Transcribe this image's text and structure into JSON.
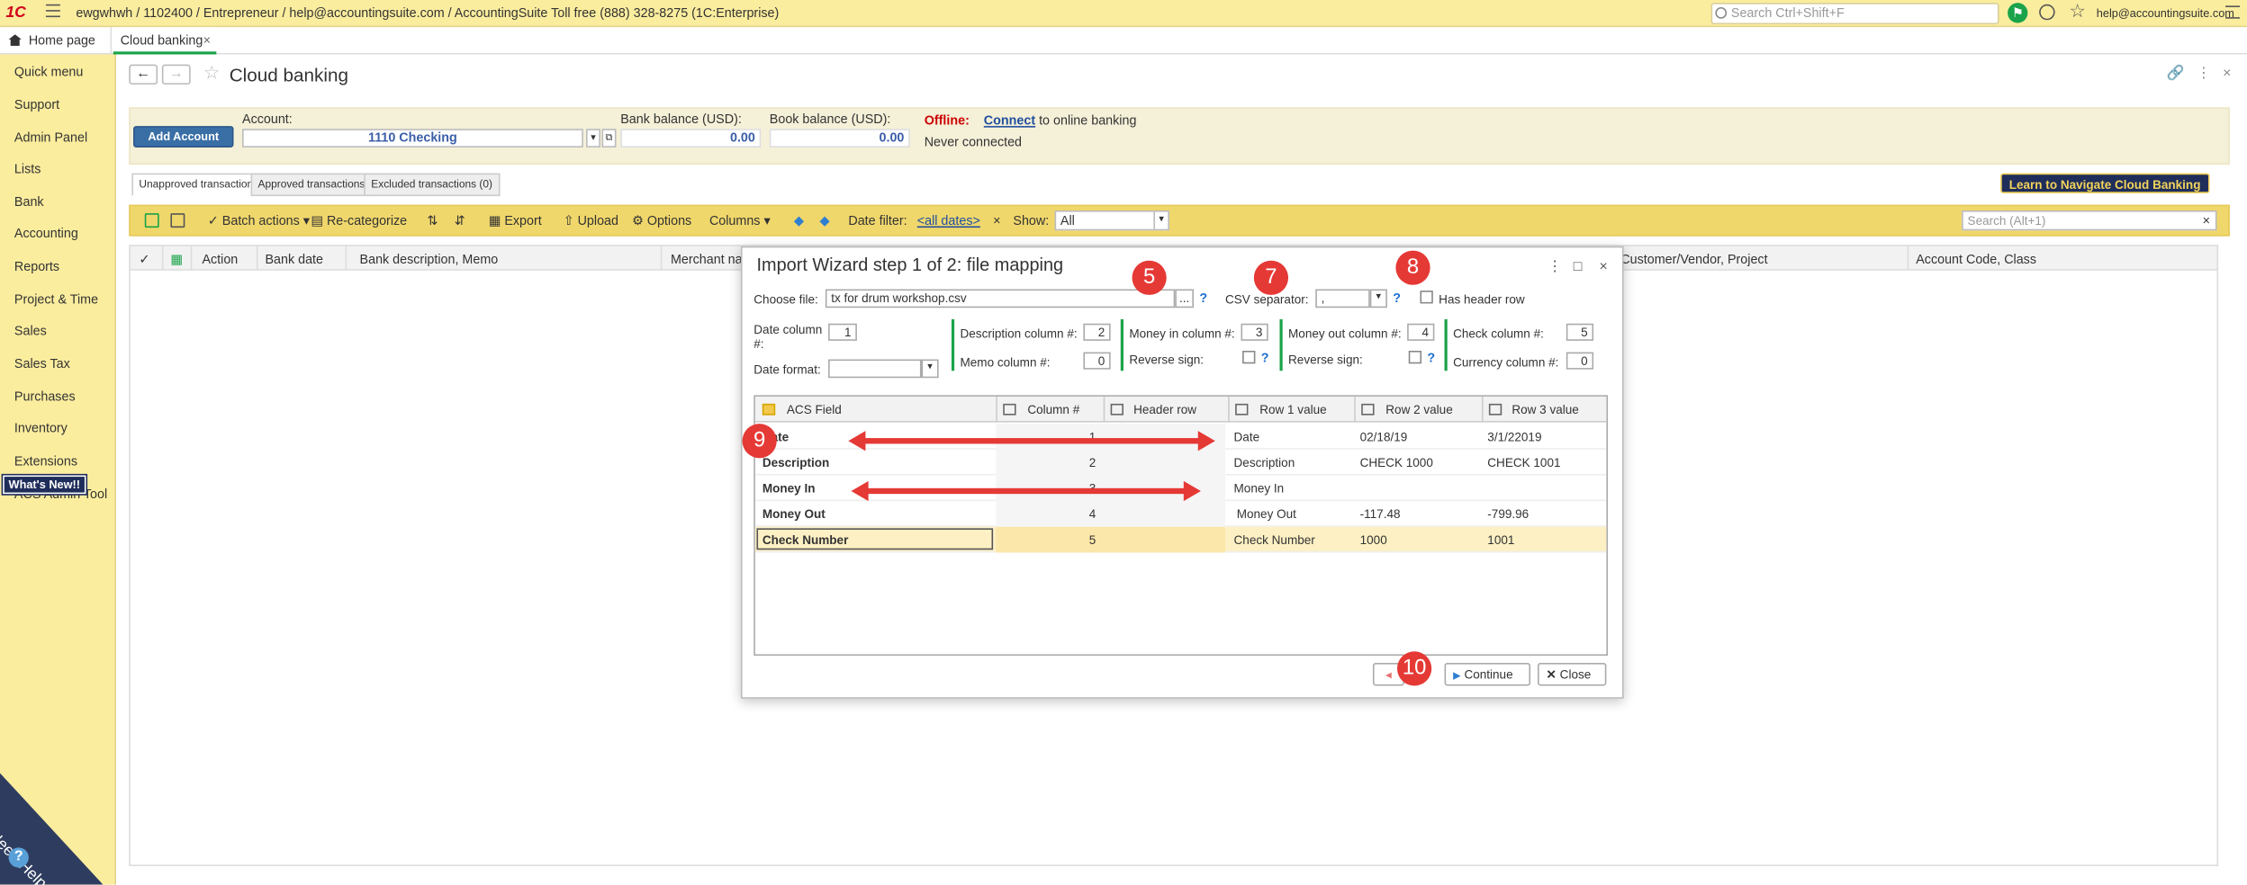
{
  "topbar": {
    "logo": "1C",
    "breadcrumb": "ewgwhwh / 1102400 / Entrepreneur / help@accountingsuite.com / AccountingSuite Toll free (888) 328-8275  (1C:Enterprise)",
    "search_placeholder": "Search Ctrl+Shift+F",
    "user_email": "help@accountingsuite.com"
  },
  "tabs": {
    "home": "Home page",
    "current": "Cloud banking"
  },
  "sidebar": {
    "items": [
      "Quick menu",
      "Support",
      "Admin Panel",
      "Lists",
      "Bank",
      "Accounting",
      "Reports",
      "Project & Time",
      "Sales",
      "Sales Tax",
      "Purchases",
      "Inventory",
      "Extensions"
    ],
    "whats_new": "What's New!!",
    "acs_admin": "ACS Admin Tool",
    "need_help": "Need Help"
  },
  "page": {
    "title": "Cloud banking",
    "add_account": "Add Account",
    "account_label": "Account:",
    "account_value": "1110 Checking",
    "bank_balance_label": "Bank balance (USD):",
    "bank_balance_value": "0.00",
    "book_balance_label": "Book balance (USD):",
    "book_balance_value": "0.00",
    "offline_label": "Offline:",
    "connect_link": "Connect",
    "connect_suffix": " to online banking",
    "never_connected": "Never connected",
    "learn_button": "Learn to Navigate Cloud Banking"
  },
  "trx_tabs": [
    "Unapproved transactions",
    "Approved transactions",
    "Excluded transactions (0)"
  ],
  "toolbar": {
    "batch_actions": "Batch actions",
    "recategorize": "Re-categorize",
    "export": "Export",
    "upload": "Upload",
    "options": "Options",
    "columns": "Columns",
    "date_filter_label": "Date filter:",
    "date_filter_value": "<all dates>",
    "show_label": "Show:",
    "show_value": "All",
    "search_placeholder": "Search (Alt+1)"
  },
  "grid": {
    "columns": [
      "Action",
      "Bank date",
      "Bank description, Memo",
      "Merchant nam",
      "Customer/Vendor, Project",
      "Account Code, Class"
    ]
  },
  "dialog": {
    "title": "Import Wizard step 1 of 2: file mapping",
    "choose_file_label": "Choose file:",
    "choose_file_value": "tx for drum workshop.csv",
    "csv_sep_label": "CSV separator:",
    "csv_sep_value": ",",
    "has_header_label": "Has header row",
    "date_col_label": "Date column #:",
    "date_col_value": "1",
    "date_format_label": "Date format:",
    "desc_col_label": "Description column #:",
    "desc_col_value": "2",
    "memo_col_label": "Memo column #:",
    "memo_col_value": "0",
    "money_in_label": "Money in column #:",
    "money_in_value": "3",
    "rev_sign_label": "Reverse sign:",
    "money_out_label": "Money out column #:",
    "money_out_value": "4",
    "check_col_label": "Check column #:",
    "check_col_value": "5",
    "currency_col_label": "Currency column #:",
    "currency_col_value": "0",
    "table_headers": [
      "ACS Field",
      "Column #",
      "Header row",
      "Row 1 value",
      "Row 2 value",
      "Row 3 value"
    ],
    "rows": [
      {
        "field": "Date",
        "col": "1",
        "header": "",
        "r1": "Date",
        "r2": "02/18/19",
        "r3": "3/1/22019"
      },
      {
        "field": "Description",
        "col": "2",
        "header": "",
        "r1": "Description",
        "r2": "CHECK 1000",
        "r3": "CHECK 1001"
      },
      {
        "field": "Money In",
        "col": "3",
        "header": "",
        "r1": "Money In",
        "r2": "",
        "r3": ""
      },
      {
        "field": "Money Out",
        "col": "4",
        "header": "",
        "r1": "Money Out",
        "r2": "-117.48",
        "r3": "-799.96"
      },
      {
        "field": "Check Number",
        "col": "5",
        "header": "",
        "r1": "Check Number",
        "r2": "1000",
        "r3": "1001"
      }
    ],
    "continue": "Continue",
    "close": "Close"
  },
  "annotations": [
    "5",
    "7",
    "8",
    "9",
    "10"
  ],
  "colors": {
    "accent": "#1aa34a",
    "badge": "#e53935",
    "sidebar": "#fbed9e",
    "toolbar": "#f0d76b"
  }
}
